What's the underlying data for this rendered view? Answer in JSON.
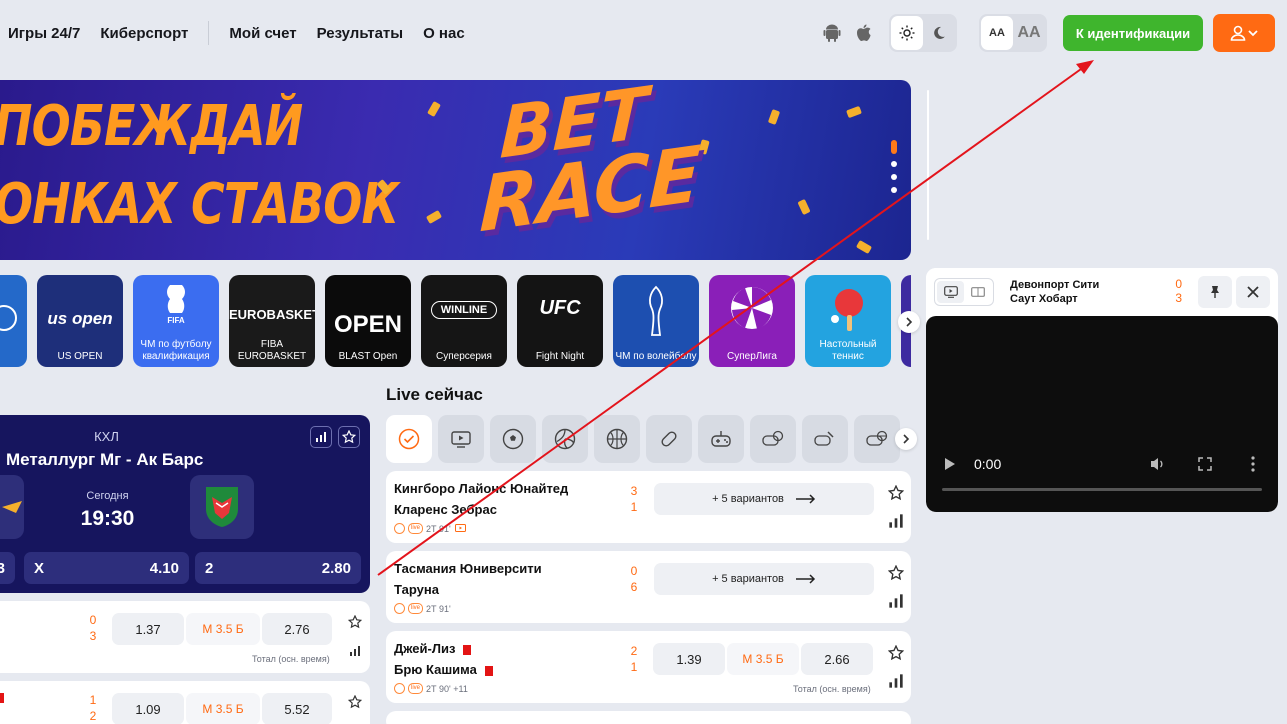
{
  "nav": {
    "items": [
      "Игры 24/7",
      "Киберспорт",
      "Мой счет",
      "Результаты",
      "О нас"
    ]
  },
  "header": {
    "font_small": "AA",
    "font_big": "AA",
    "ident_button": "К идентификации",
    "accent_green": "#3fb52d",
    "accent_orange": "#ff6a13"
  },
  "banner": {
    "line1": "ПОБЕЖДАЙ",
    "line2": "ОНКАХ СТАВОК",
    "promo_word1": "BET",
    "promo_word2": "RACE"
  },
  "categories": [
    {
      "label": "",
      "logo": "",
      "color": "#2469c9",
      "icon": "globe-icon"
    },
    {
      "label": "US OPEN",
      "logo": "us open",
      "color": "#1e2f7a",
      "icon": "us-open-logo"
    },
    {
      "label": "ЧМ по футболу квалификация",
      "logo": "FIFA",
      "color": "#3b6df0",
      "icon": "fifa-trophy-logo"
    },
    {
      "label": "FIBA EUROBASKET",
      "logo": "EUROBASKET",
      "color": "#1a1a1a",
      "icon": "eurobasket-logo"
    },
    {
      "label": "BLAST Open",
      "logo": "OPEN",
      "color": "#0b0b0b",
      "icon": "blast-open-logo"
    },
    {
      "label": "Суперсерия",
      "logo": "WINLINE",
      "color": "#151515",
      "icon": "winline-logo"
    },
    {
      "label": "Fight Night",
      "logo": "UFC",
      "color": "#141414",
      "icon": "ufc-logo"
    },
    {
      "label": "ЧМ по волейболу",
      "logo": "",
      "color": "#1d4fb0",
      "icon": "volleyball-cup-logo"
    },
    {
      "label": "СуперЛига",
      "logo": "",
      "color": "#8a1fb8",
      "icon": "superliga-logo"
    },
    {
      "label": "Настольный теннис",
      "logo": "",
      "color": "#23a3e0",
      "icon": "table-tennis-icon"
    }
  ],
  "featured": {
    "league": "КХЛ",
    "title": "Металлург Мг - Ак Барс",
    "when": "Сегодня",
    "time": "19:30",
    "odds": [
      {
        "label": "",
        "value": "3"
      },
      {
        "label": "X",
        "value": "4.10"
      },
      {
        "label": "2",
        "value": "2.80"
      }
    ]
  },
  "left_matches": [
    {
      "s1": "0",
      "s2": "3",
      "odd1": "1.37",
      "mid": "М 3.5 Б",
      "odd2": "2.76",
      "note": "Тотал (осн. время)"
    },
    {
      "s1": "1",
      "s2": "2",
      "odd1": "1.09",
      "mid": "М 3.5 Б",
      "odd2": "5.52",
      "note": ""
    }
  ],
  "live": {
    "title": "Live сейчас",
    "sports": [
      "check-icon",
      "tv-icon",
      "football-icon",
      "volleyball-icon",
      "basketball-icon",
      "hockey-puck-icon",
      "gamepad-icon",
      "esports-football-icon",
      "esports-hockey-icon",
      "esports-basketball-icon"
    ]
  },
  "live_matches": [
    {
      "team1": "Кингборо Лайонс Юнайтед",
      "team2": "Кларенс Зебрас",
      "s1": "3",
      "s2": "1",
      "time": "2Т 91'",
      "variants": "+ 5 вариантов"
    },
    {
      "team1": "Тасмания Юниверсити",
      "team2": "Таруна",
      "s1": "0",
      "s2": "6",
      "time": "2Т 91'",
      "variants": "+ 5 вариантов"
    },
    {
      "team1": "Джей-Лиз",
      "team2": "Брю Кашима",
      "s1": "2",
      "s2": "1",
      "time": "2Т 90' +11",
      "odd1": "1.39",
      "mid": "М 3.5 Б",
      "odd2": "2.66",
      "note": "Тотал (осн. время)"
    }
  ],
  "player": {
    "team1": "Девонпорт Сити",
    "team2": "Саут Хобарт",
    "s1": "0",
    "s2": "3",
    "time": "0:00"
  }
}
